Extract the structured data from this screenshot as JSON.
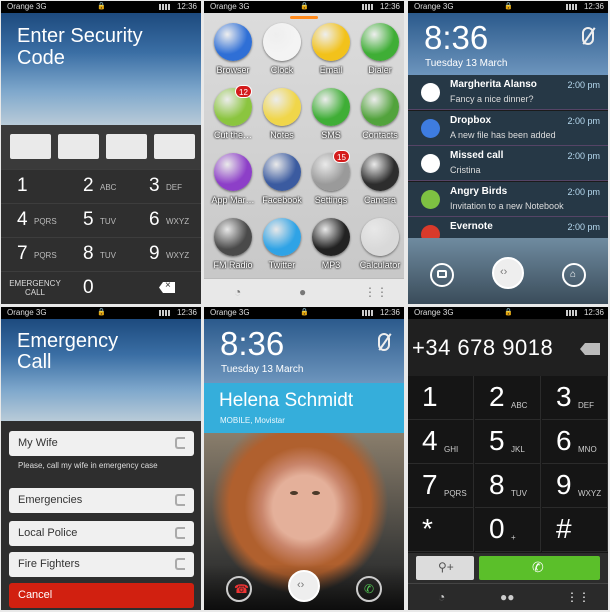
{
  "status": {
    "carrier": "Orange 3G",
    "time": "12:36"
  },
  "security": {
    "title": "Enter Security Code",
    "keys": [
      {
        "d": "1",
        "l": ""
      },
      {
        "d": "2",
        "l": "ABC"
      },
      {
        "d": "3",
        "l": "DEF"
      },
      {
        "d": "4",
        "l": "PQRS"
      },
      {
        "d": "5",
        "l": "TUV"
      },
      {
        "d": "6",
        "l": "WXYZ"
      },
      {
        "d": "7",
        "l": "PQRS"
      },
      {
        "d": "8",
        "l": "TUV"
      },
      {
        "d": "9",
        "l": "WXYZ"
      }
    ],
    "emergency_label": "EMERGENCY CALL",
    "zero": "0"
  },
  "home": {
    "apps": [
      {
        "name": "Browser",
        "color": "#2f6fd6"
      },
      {
        "name": "Clock",
        "color": "#f4f4f4"
      },
      {
        "name": "Email",
        "color": "#f2c21b"
      },
      {
        "name": "Dialer",
        "color": "#3fae36"
      },
      {
        "name": "Cut the…",
        "color": "#8bc53f",
        "badge": "12"
      },
      {
        "name": "Notes",
        "color": "#f0d64a"
      },
      {
        "name": "SMS",
        "color": "#3fae36"
      },
      {
        "name": "Contacts",
        "color": "#52a33c"
      },
      {
        "name": "App Mar…",
        "color": "#8d3fc8"
      },
      {
        "name": "Facebook",
        "color": "#3b5ba0"
      },
      {
        "name": "Settings",
        "color": "#9a9a9a",
        "badge": "15"
      },
      {
        "name": "Camera",
        "color": "#2d2d2d"
      },
      {
        "name": "FM Radio",
        "color": "#4a4a4a"
      },
      {
        "name": "Twitter",
        "color": "#2fa3e6"
      },
      {
        "name": "MP3",
        "color": "#222222"
      },
      {
        "name": "Calculator",
        "color": "#d9d9d9"
      }
    ]
  },
  "lock": {
    "time": "8:36",
    "date": "Tuesday 13 March",
    "notifications": [
      {
        "title": "Margherita Alanso",
        "body": "Fancy a nice dinner?",
        "time": "2:00 pm"
      },
      {
        "title": "Dropbox",
        "body": "A new file has been added",
        "time": "2:00 pm"
      },
      {
        "title": "Missed call",
        "body": "Cristina",
        "time": "2:00 pm"
      },
      {
        "title": "Angry Birds",
        "body": "Invitation to a new Notebook",
        "time": "2:00 pm"
      },
      {
        "title": "Evernote",
        "body": "",
        "time": "2:00 pm"
      }
    ]
  },
  "emergency": {
    "title": "Emergency Call",
    "contacts": [
      "My Wife",
      "Emergencies",
      "Local Police",
      "Fire Fighters"
    ],
    "note": "Please, call my wife in emergency case",
    "cancel": "Cancel"
  },
  "incoming": {
    "time": "8:36",
    "date": "Tuesday 13 March",
    "caller": "Helena Schmidt",
    "sub": "MOBILE, Movistar"
  },
  "dialer": {
    "number": "+34 678 9018",
    "keys": [
      {
        "d": "1",
        "l": ""
      },
      {
        "d": "2",
        "l": "ABC"
      },
      {
        "d": "3",
        "l": "DEF"
      },
      {
        "d": "4",
        "l": "GHI"
      },
      {
        "d": "5",
        "l": "JKL"
      },
      {
        "d": "6",
        "l": "MNO"
      },
      {
        "d": "7",
        "l": "PQRS"
      },
      {
        "d": "8",
        "l": "TUV"
      },
      {
        "d": "9",
        "l": "WXYZ"
      },
      {
        "d": "*",
        "l": ""
      },
      {
        "d": "0",
        "l": "+"
      },
      {
        "d": "#",
        "l": ""
      }
    ]
  }
}
